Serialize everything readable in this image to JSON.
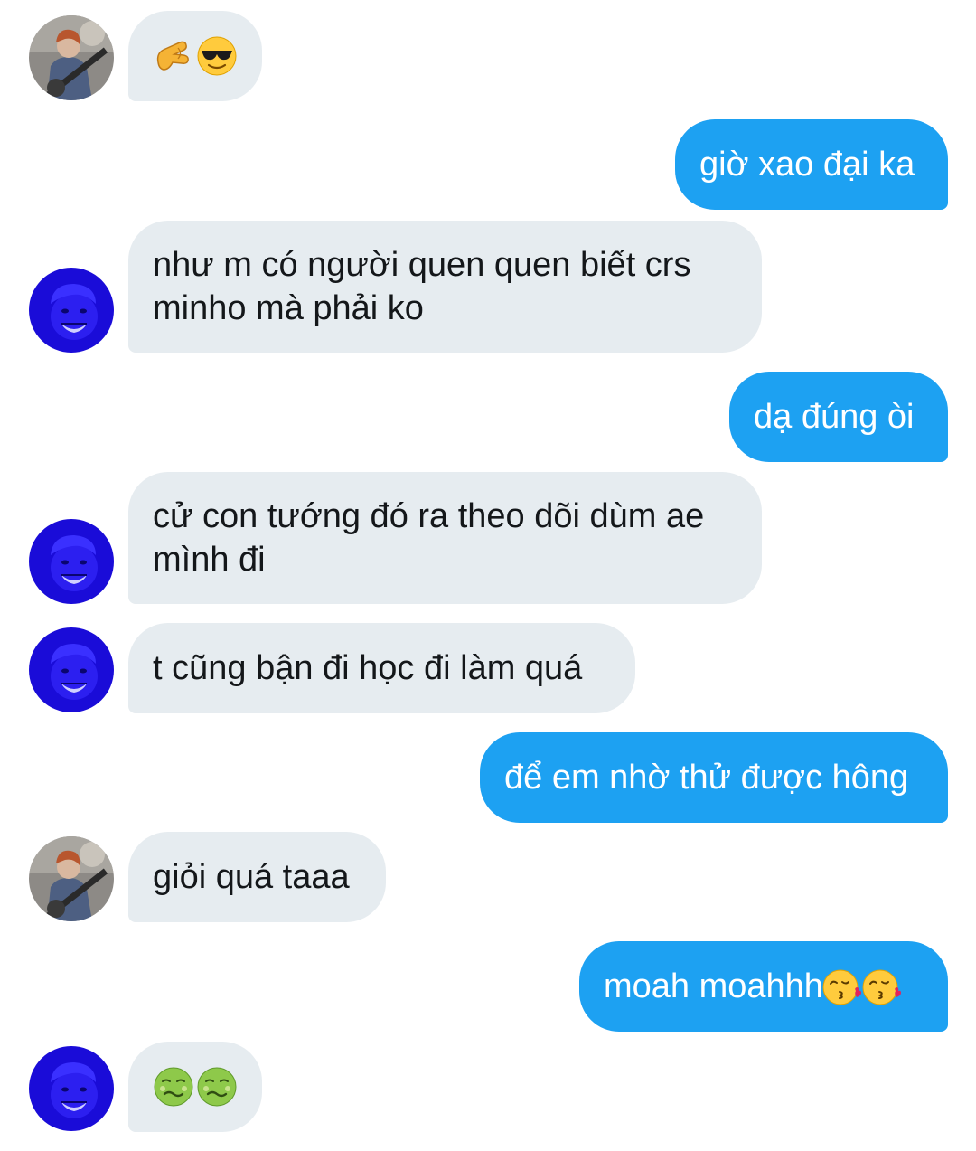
{
  "conversation": {
    "messages": [
      {
        "sender": "them",
        "avatar": "guitar-photo-avatar",
        "emojis": [
          "pinching-hand-emoji",
          "sunglasses-emoji"
        ]
      },
      {
        "sender": "me",
        "text": "giờ xao đại ka"
      },
      {
        "sender": "them",
        "avatar": "blue-photo-avatar",
        "lines": [
          "như m có người quen quen biết crs",
          "minho mà phải ko"
        ]
      },
      {
        "sender": "me",
        "text": "dạ đúng òi"
      },
      {
        "sender": "them",
        "avatar": "blue-photo-avatar",
        "lines": [
          "cử con tướng đó ra theo dõi dùm ae",
          "mình đi"
        ]
      },
      {
        "sender": "them",
        "avatar": "blue-photo-avatar",
        "text": "t cũng bận đi học đi làm quá"
      },
      {
        "sender": "me",
        "text": "để em nhờ thử được hông"
      },
      {
        "sender": "them",
        "avatar": "guitar-photo-avatar",
        "text": "giỏi quá taaa"
      },
      {
        "sender": "me",
        "text": "moah moahhh",
        "emojis": [
          "kissing-face-emoji",
          "kissing-face-emoji"
        ]
      },
      {
        "sender": "them",
        "avatar": "blue-photo-avatar",
        "emojis": [
          "nauseated-face-emoji",
          "nauseated-face-emoji"
        ]
      }
    ]
  },
  "colors": {
    "incoming_bubble": "#e6ecf0",
    "outgoing_bubble": "#1da1f2",
    "incoming_text": "#14171a",
    "outgoing_text": "#ffffff"
  }
}
